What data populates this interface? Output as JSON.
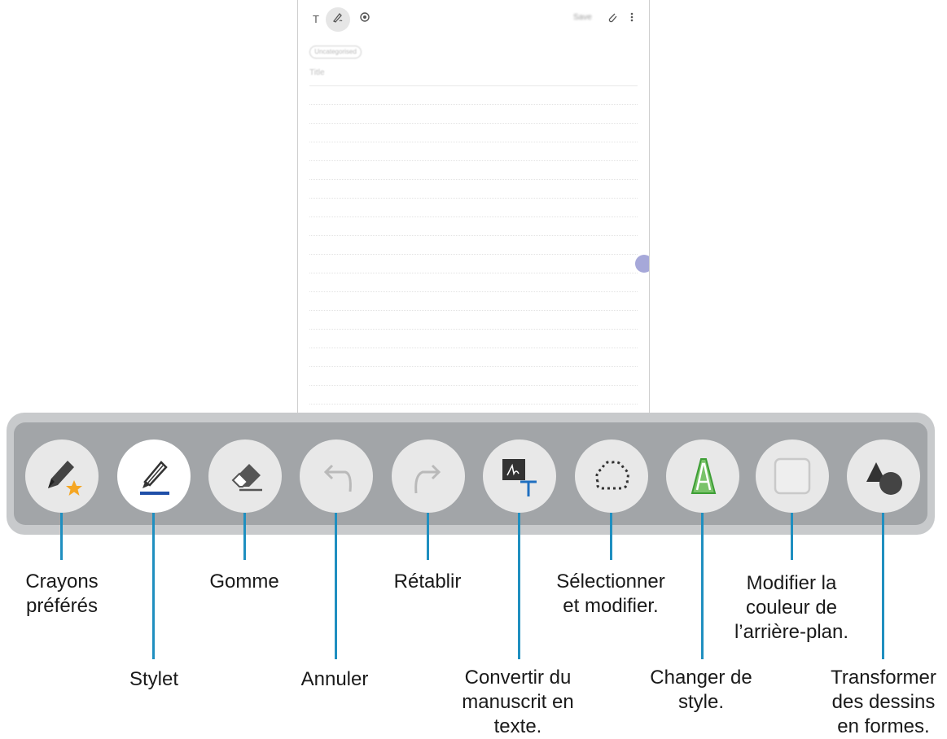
{
  "note": {
    "toolbar": {
      "text_mode_icon": "T",
      "save_label": "Save"
    },
    "category_chip": "Uncategorised",
    "title_placeholder": "Title"
  },
  "tools": [
    {
      "name": "favorite-pens",
      "icon": "pen-star-icon"
    },
    {
      "name": "pen",
      "icon": "fountain-pen-icon",
      "active": true
    },
    {
      "name": "eraser",
      "icon": "eraser-icon"
    },
    {
      "name": "undo",
      "icon": "undo-arrow-icon"
    },
    {
      "name": "redo",
      "icon": "redo-arrow-icon"
    },
    {
      "name": "convert-to-text",
      "icon": "handwriting-to-text-icon"
    },
    {
      "name": "selection",
      "icon": "lasso-icon"
    },
    {
      "name": "change-style",
      "icon": "outlined-letter-a-icon"
    },
    {
      "name": "background-color",
      "icon": "square-icon"
    },
    {
      "name": "shapes",
      "icon": "shapes-icon"
    }
  ],
  "labels": {
    "crayons_l1": "Crayons",
    "crayons_l2": "préférés",
    "stylet": "Stylet",
    "gomme": "Gomme",
    "annuler": "Annuler",
    "retablir": "Rétablir",
    "convertir_l1": "Convertir du",
    "convertir_l2": "manuscrit en",
    "convertir_l3": "texte.",
    "selectionner_l1": "Sélectionner",
    "selectionner_l2": "et modifier.",
    "changer_l1": "Changer de",
    "changer_l2": "style.",
    "modifier_l1": "Modifier la",
    "modifier_l2": "couleur de",
    "modifier_l3": "l’arrière-plan.",
    "transformer_l1": "Transformer",
    "transformer_l2": "des dessins",
    "transformer_l3": "en formes."
  },
  "colors": {
    "leader": "#1f8fc0",
    "toolbar_outer": "#c8cacc",
    "toolbar_inner": "#a2a5a8",
    "pen_underline": "#1f4fa8",
    "star": "#f5a623",
    "style_green": "#4caf50",
    "fab": "#a6a8d9"
  }
}
